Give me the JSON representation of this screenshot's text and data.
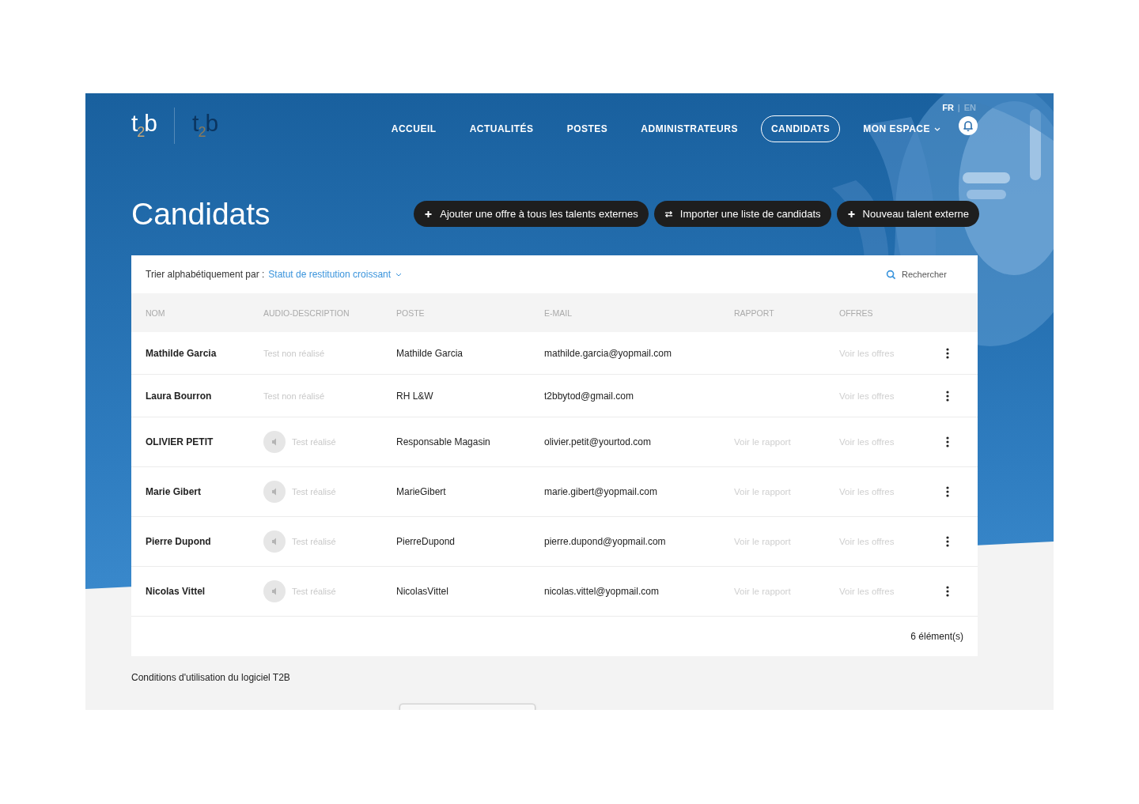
{
  "header": {
    "logos": [
      "t$_{2}$b",
      "t$_{2}$b"
    ],
    "languages": [
      {
        "label": "FR",
        "selected": true
      },
      {
        "label": "EN",
        "selected": false
      }
    ],
    "language_separator": "|",
    "nav": [
      {
        "label": "ACCUEIL",
        "selected": false,
        "kind": "link"
      },
      {
        "label": "ACTUALITÉS",
        "selected": false,
        "kind": "link"
      },
      {
        "label": "POSTES",
        "selected": false,
        "kind": "link"
      },
      {
        "label": "ADMINISTRATEURS",
        "selected": false,
        "kind": "link"
      },
      {
        "label": "CANDIDATS",
        "selected": true,
        "kind": "link"
      },
      {
        "label": "MON ESPACE",
        "selected": false,
        "kind": "dropdown"
      }
    ]
  },
  "title": "Candidats",
  "actions": [
    {
      "label": "Ajouter une offre à tous les talents externes",
      "kind": "plus"
    },
    {
      "label": "Importer une liste de candidats",
      "kind": "swap"
    },
    {
      "label": "Nouveau talent externe",
      "kind": "plus"
    }
  ],
  "sort": {
    "label": "Trier alphabétiquement par :",
    "value": "Statut de restitution croissant"
  },
  "search": {
    "placeholder": "Rechercher"
  },
  "table": {
    "columns": [
      "NOM",
      "AUDIO-DESCRIPTION",
      "POSTE",
      "E-MAIL",
      "RAPPORT",
      "OFFRES"
    ],
    "rows": [
      {
        "name": "Mathilde Garcia",
        "audio": "Test non réalisé",
        "tested": false,
        "poste": "Mathilde Garcia",
        "email": "mathilde.garcia@yopmail.com",
        "offres": "Voir les offres"
      },
      {
        "name": "Laura Bourron",
        "audio": "Test non réalisé",
        "tested": false,
        "poste": "RH L&W",
        "email": "t2bbytod@gmail.com",
        "offres": "Voir les offres"
      },
      {
        "name": "OLIVIER PETIT",
        "audio": "Test réalisé",
        "tested": true,
        "poste": "Responsable Magasin",
        "email": "olivier.petit@yourtod.com",
        "rapport": "Voir le rapport",
        "offres": "Voir les offres"
      },
      {
        "name": "Marie Gibert",
        "audio": "Test réalisé",
        "tested": true,
        "poste": "MarieGibert",
        "email": "marie.gibert@yopmail.com",
        "rapport": "Voir le rapport",
        "offres": "Voir les offres"
      },
      {
        "name": "Pierre Dupond",
        "audio": "Test réalisé",
        "tested": true,
        "poste": "PierreDupond",
        "email": "pierre.dupond@yopmail.com",
        "rapport": "Voir le rapport",
        "offres": "Voir les offres"
      },
      {
        "name": "Nicolas Vittel",
        "audio": "Test réalisé",
        "tested": true,
        "poste": "NicolasVittel",
        "email": "nicolas.vittel@yopmail.com",
        "rapport": "Voir le rapport",
        "offres": "Voir les offres"
      }
    ],
    "count": "6 élément(s)"
  },
  "footer": {
    "link": "Conditions d'utilisation du logiciel T2B"
  }
}
